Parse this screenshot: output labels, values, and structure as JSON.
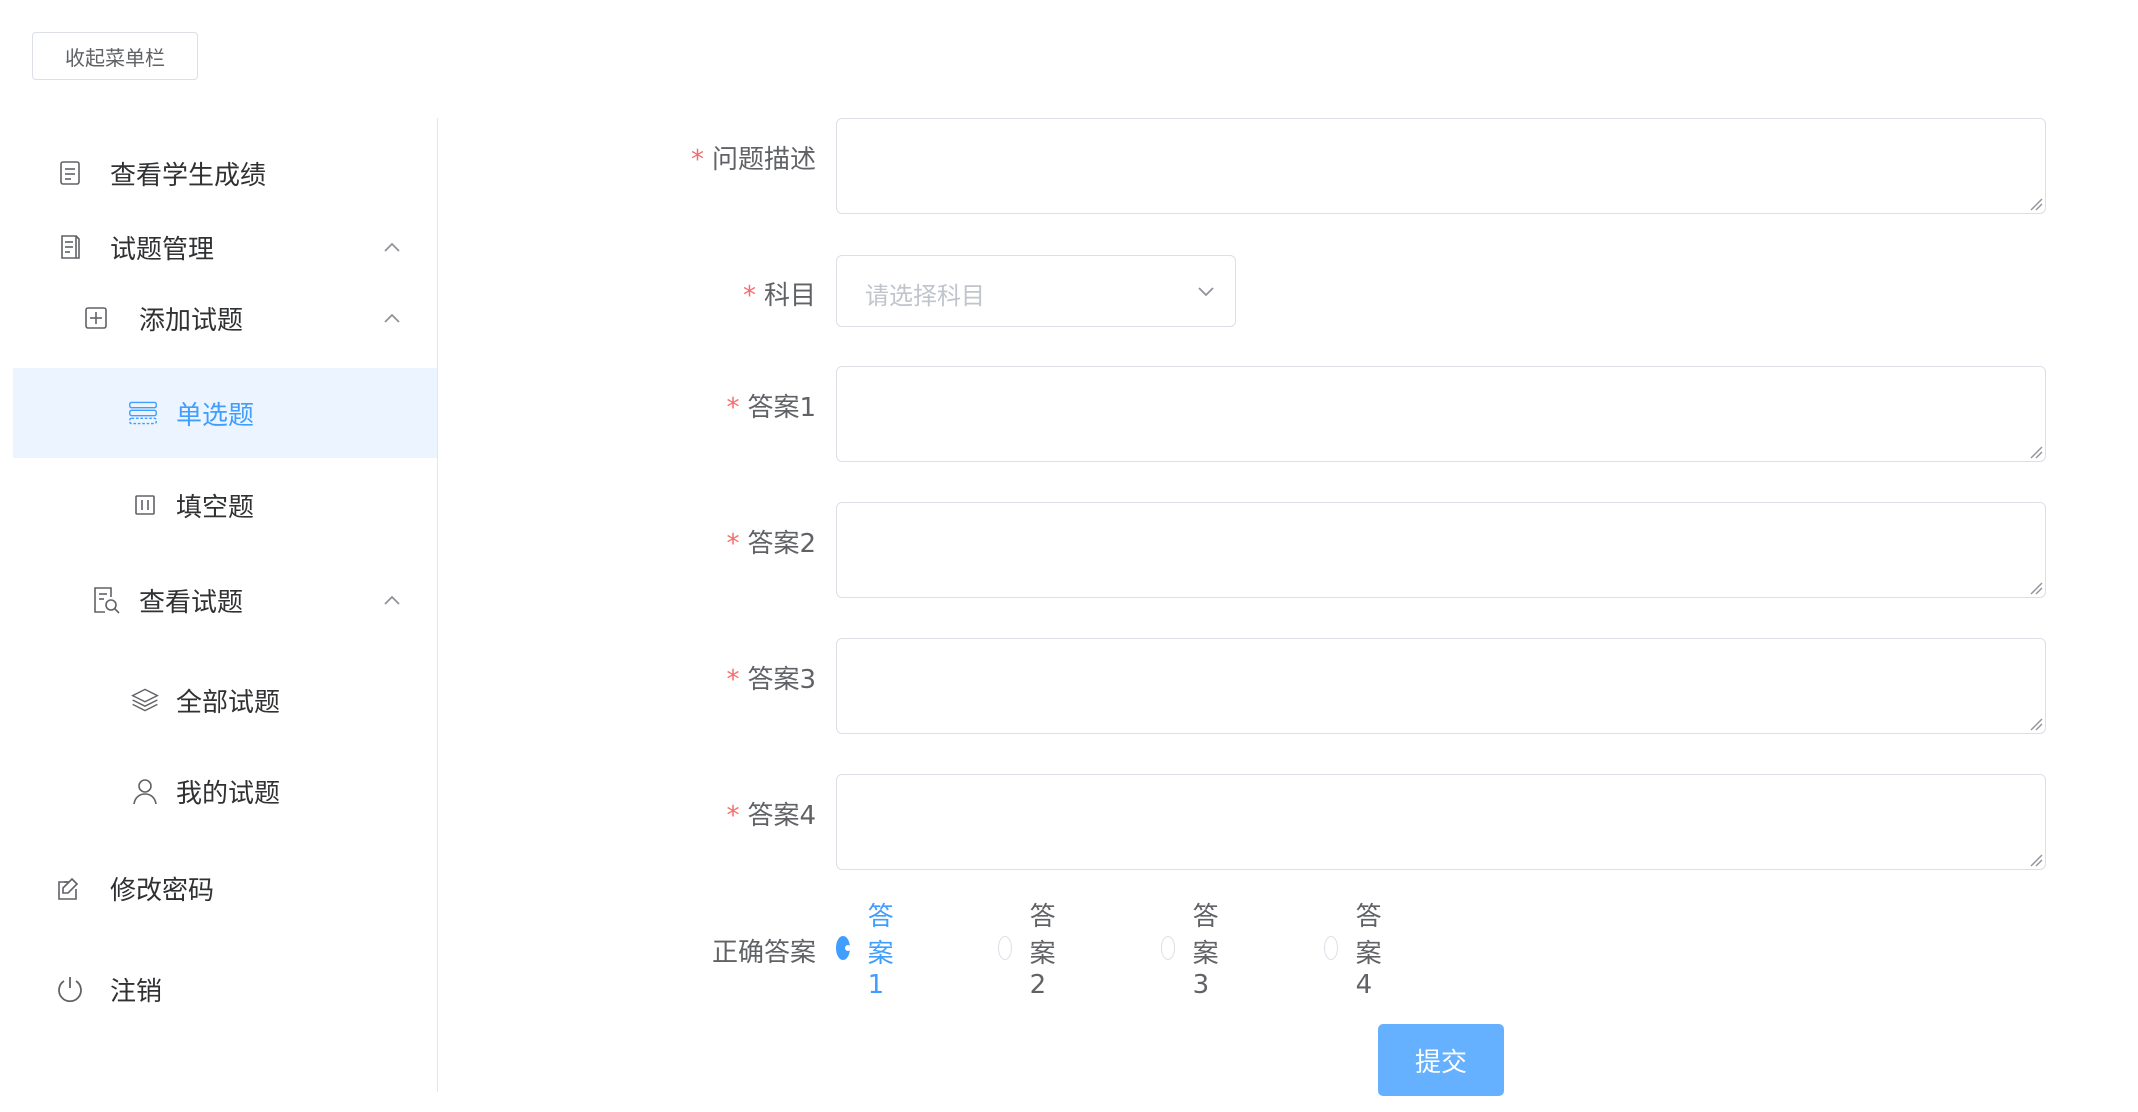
{
  "toolbar": {
    "collapse_label": "收起菜单栏"
  },
  "sidebar": {
    "items": [
      {
        "label": "查看学生成绩",
        "icon": "document-icon"
      },
      {
        "label": "试题管理",
        "icon": "file-list-icon"
      },
      {
        "label": "添加试题",
        "icon": "plus-square-icon"
      },
      {
        "label": "单选题",
        "icon": "list-icon"
      },
      {
        "label": "填空题",
        "icon": "columns-icon"
      },
      {
        "label": "查看试题",
        "icon": "document-search-icon"
      },
      {
        "label": "全部试题",
        "icon": "layers-icon"
      },
      {
        "label": "我的试题",
        "icon": "user-icon"
      },
      {
        "label": "修改密码",
        "icon": "edit-icon"
      },
      {
        "label": "注销",
        "icon": "power-icon"
      }
    ]
  },
  "form": {
    "required_mark": "*",
    "question_label": "问题描述",
    "subject_label": "科目",
    "subject_placeholder": "请选择科目",
    "answer1_label": "答案1",
    "answer2_label": "答案2",
    "answer3_label": "答案3",
    "answer4_label": "答案4",
    "correct_label": "正确答案",
    "radios": [
      "答案1",
      "答案2",
      "答案3",
      "答案4"
    ],
    "selected": "答案1",
    "submit_label": "提交"
  },
  "colors": {
    "accent": "#409eff",
    "active_bg": "#ecf5ff",
    "required": "#f56c6c",
    "submit_bg": "#66b1ff"
  }
}
